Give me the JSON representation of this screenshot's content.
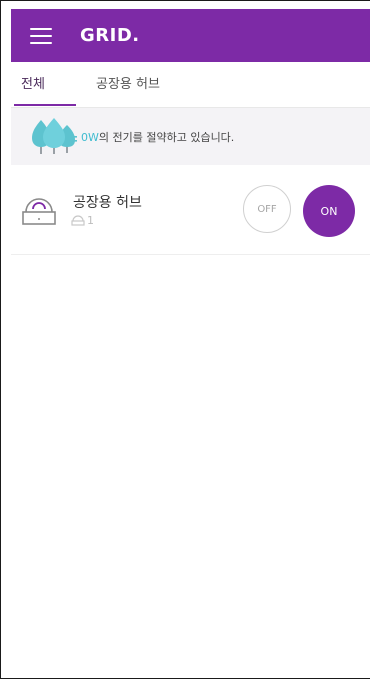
{
  "app": {
    "title": "GRID.",
    "brand_color": "#7d2aa6",
    "accent_color": "#41bcd0"
  },
  "tabs": [
    {
      "label": "전체",
      "active": true
    },
    {
      "label": "공장용 허브",
      "active": false
    }
  ],
  "savings": {
    "amount": "0W",
    "message": "의 전기를 절약하고 있습니다.",
    "icon": "tree-icon"
  },
  "devices": [
    {
      "name": "공장용 허브",
      "count": "1",
      "icon": "hub-icon",
      "meta_icon": "plug-icon",
      "off_label": "OFF",
      "on_label": "ON",
      "state": "on"
    }
  ]
}
